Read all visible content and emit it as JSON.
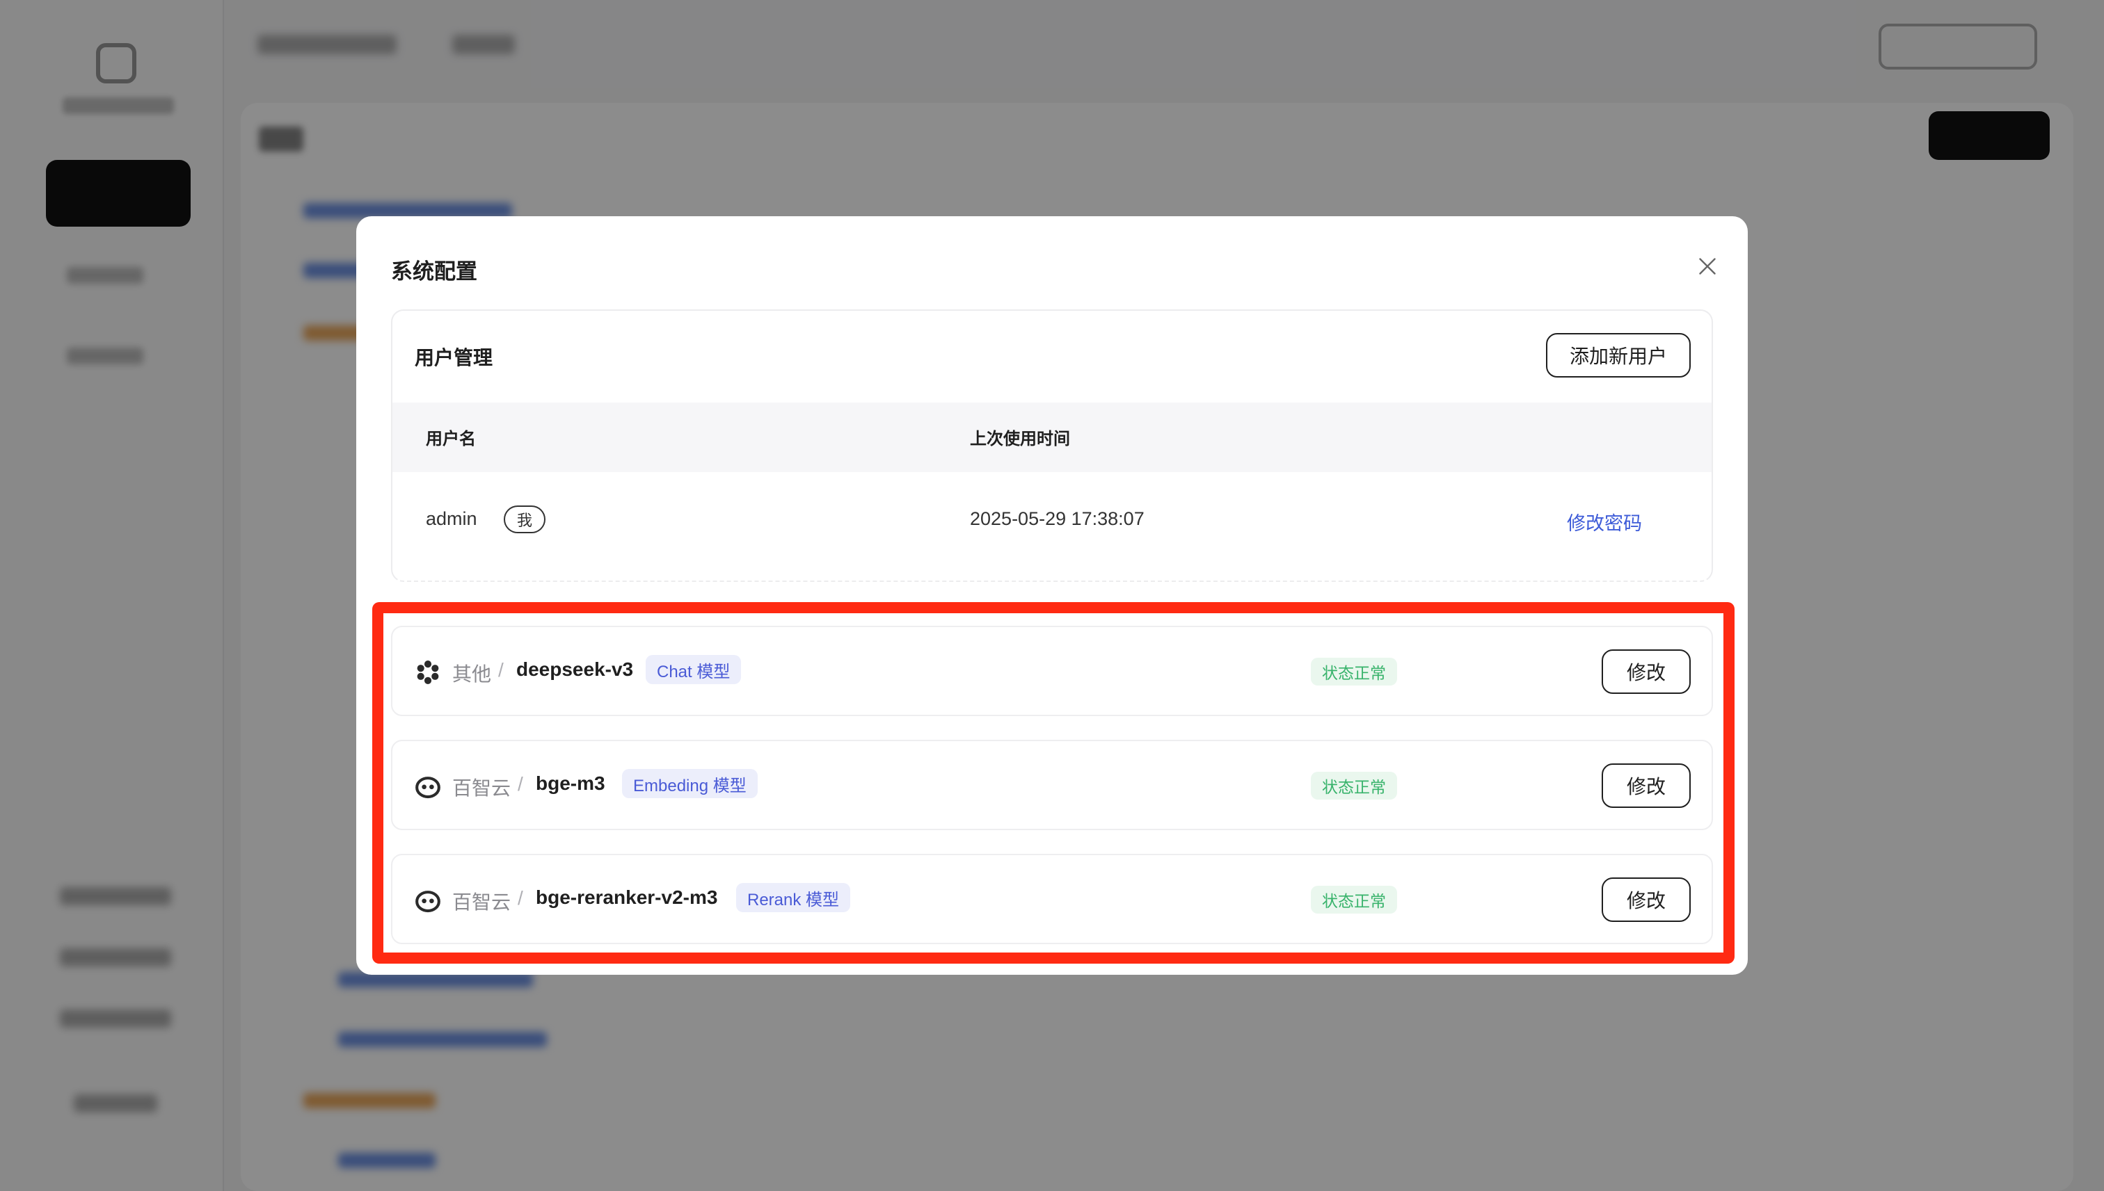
{
  "dialog": {
    "title": "系统配置",
    "user_management": {
      "title": "用户管理",
      "add_user_label": "添加新用户",
      "columns": {
        "username": "用户名",
        "last_used": "上次使用时间"
      },
      "rows": [
        {
          "username": "admin",
          "badge": "我",
          "last_used": "2025-05-29 17:38:07",
          "action": "修改密码"
        }
      ]
    },
    "models": [
      {
        "provider": "其他",
        "name": "deepseek-v3",
        "type_tag": "Chat 模型",
        "status": "状态正常",
        "edit_label": "修改",
        "icon": "deepseek-hexagon-icon"
      },
      {
        "provider": "百智云",
        "name": "bge-m3",
        "type_tag": "Embeding 模型",
        "status": "状态正常",
        "edit_label": "修改",
        "icon": "baizhi-cloud-icon"
      },
      {
        "provider": "百智云",
        "name": "bge-reranker-v2-m3",
        "type_tag": "Rerank 模型",
        "status": "状态正常",
        "edit_label": "修改",
        "icon": "baizhi-cloud-icon"
      }
    ],
    "separator": "/"
  },
  "colors": {
    "highlight": "#ff2a12",
    "link": "#3d5bd8",
    "status_text": "#38b36b",
    "tag_text": "#4a5bd6",
    "primary_dark": "#111111"
  }
}
